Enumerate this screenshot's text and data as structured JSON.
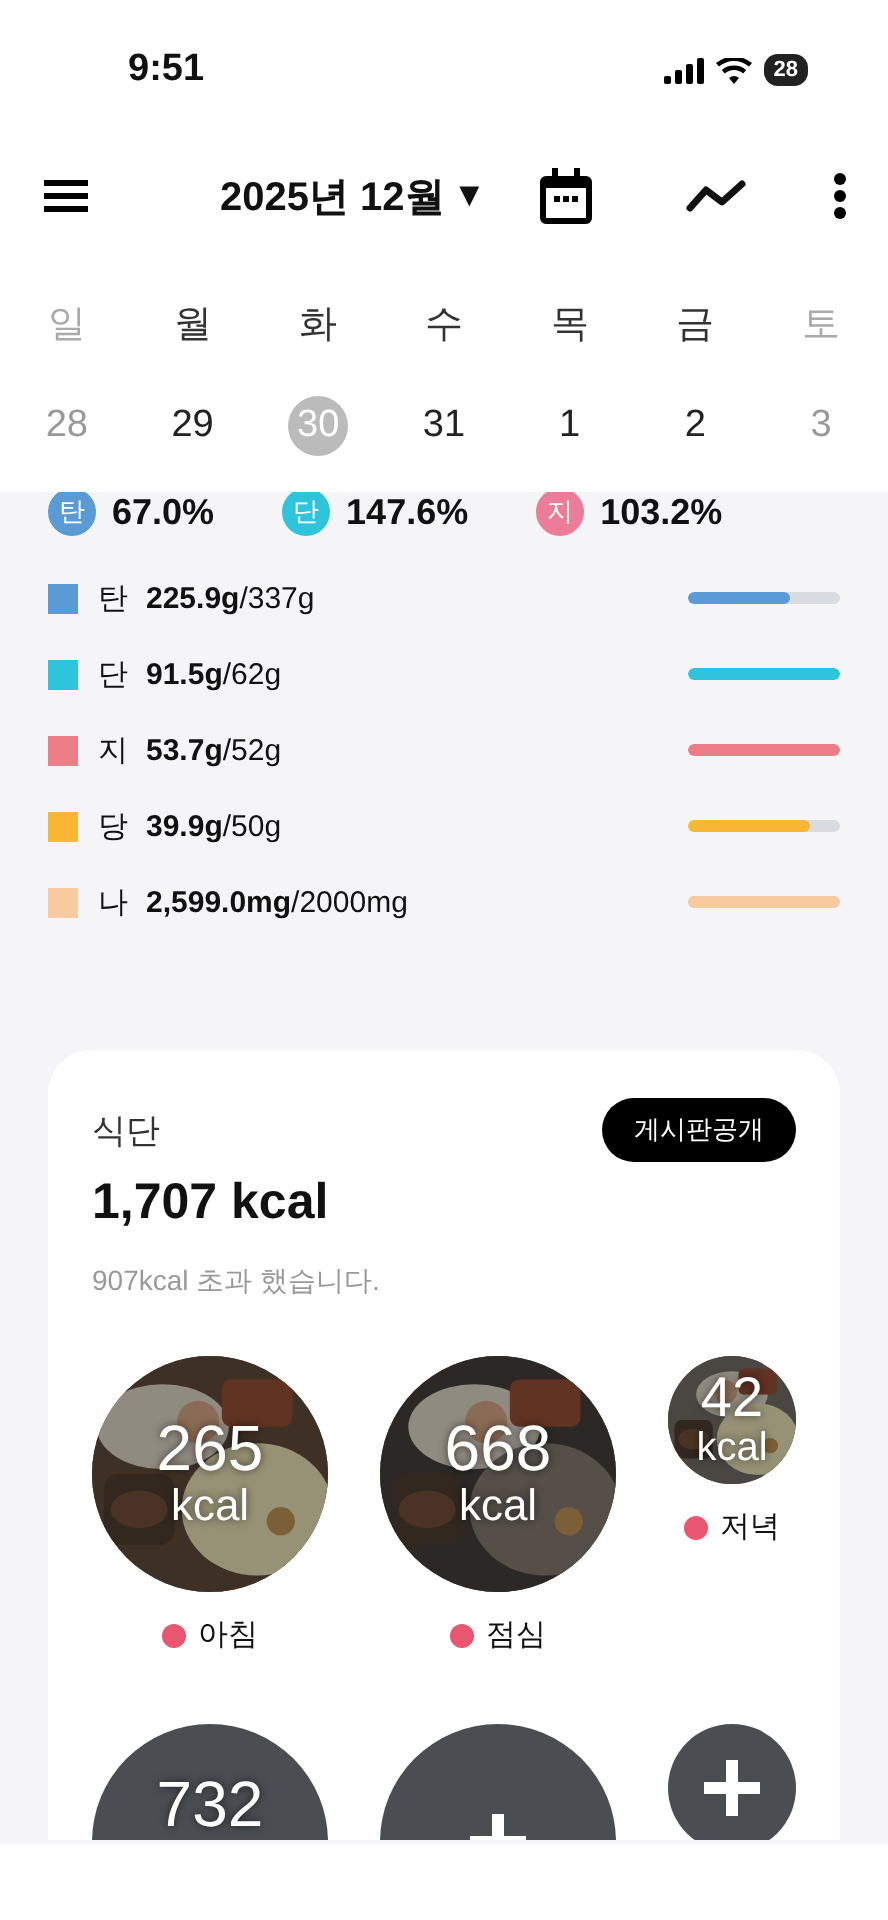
{
  "status_bar": {
    "time": "9:51",
    "battery": "28"
  },
  "header": {
    "title": "2025년 12월",
    "caret": "▼"
  },
  "week": {
    "weekdays": [
      {
        "label": "일",
        "muted": true
      },
      {
        "label": "월",
        "muted": false
      },
      {
        "label": "화",
        "muted": false
      },
      {
        "label": "수",
        "muted": false
      },
      {
        "label": "목",
        "muted": false
      },
      {
        "label": "금",
        "muted": false
      },
      {
        "label": "토",
        "muted": true
      }
    ],
    "dates": [
      {
        "label": "28",
        "muted": true,
        "selected": false
      },
      {
        "label": "29",
        "muted": false,
        "selected": false
      },
      {
        "label": "30",
        "muted": false,
        "selected": true
      },
      {
        "label": "31",
        "muted": false,
        "selected": false
      },
      {
        "label": "1",
        "muted": false,
        "selected": false
      },
      {
        "label": "2",
        "muted": false,
        "selected": false
      },
      {
        "label": "3",
        "muted": true,
        "selected": false
      }
    ]
  },
  "ratios": [
    {
      "badge": "탄",
      "value": "67.0%",
      "color": "#5b9bd5"
    },
    {
      "badge": "단",
      "value": "147.6%",
      "color": "#2ec4dc"
    },
    {
      "badge": "지",
      "value": "103.2%",
      "color": "#ec7c97"
    }
  ],
  "nutrients": [
    {
      "label": "탄",
      "amount": "**225.9g**/337g",
      "color": "#5b9bd5",
      "level": 0.67
    },
    {
      "label": "단",
      "amount": "**91.5g**/62g",
      "color": "#2ec4dc",
      "level": 1
    },
    {
      "label": "지",
      "amount": "**53.7g**/52g",
      "color": "#ec7c85",
      "level": 1
    },
    {
      "label": "당",
      "amount": "**39.9g**/50g",
      "color": "#f7b733",
      "level": 0.8
    },
    {
      "label": "나",
      "amount": "**2,599.0mg**/2000mg",
      "color": "#f8caa0",
      "level": 1
    }
  ],
  "diet": {
    "title": "식단",
    "total": "1,707 kcal",
    "note": "907kcal 초과 했습니다.",
    "share_button": "게시판공개",
    "meals": [
      {
        "compact": false,
        "kcal": "265",
        "unit": "kcal",
        "label": "아침"
      },
      {
        "compact": false,
        "kcal": "668",
        "unit": "kcal",
        "label": "점심"
      },
      {
        "compact": true,
        "kcal": "42",
        "unit": "kcal",
        "label": "저녁"
      },
      {
        "kind": "plain",
        "compact": false,
        "kcal": "732"
      },
      {
        "kind": "add",
        "compact": false
      },
      {
        "kind": "add",
        "compact": true
      }
    ]
  }
}
